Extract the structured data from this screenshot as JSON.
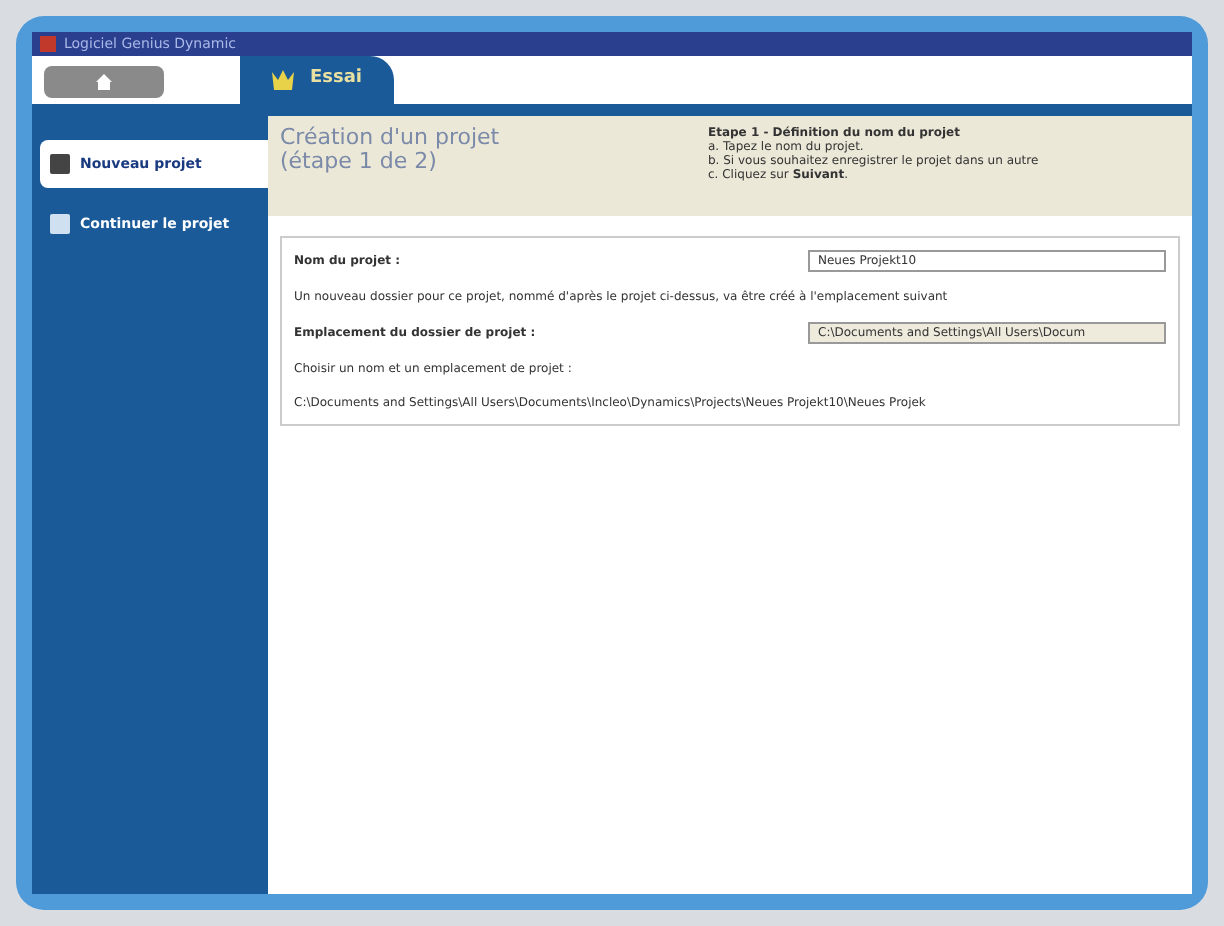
{
  "window": {
    "title": "Logiciel Genius Dynamic"
  },
  "tabs": [
    {
      "label": "Essai",
      "selected": true
    }
  ],
  "sidebar": {
    "items": [
      {
        "label": "Nouveau projet",
        "selected": true
      },
      {
        "label": "Continuer le projet",
        "selected": false
      }
    ]
  },
  "header": {
    "title": "Création d'un projet",
    "subtitle": "(étape 1 de 2)",
    "steps_title": "Etape 1 - Définition du nom du projet",
    "steps": [
      "a. Tapez le nom du projet.",
      "b. Si vous souhaitez enregistrer le projet dans un autre",
      "c. Cliquez sur **Suivant**."
    ]
  },
  "form": {
    "name_label": "Nom du projet :",
    "name_value": "Neues Projekt10",
    "info": "Un nouveau dossier pour ce projet, nommé d'après le projet ci-dessus, va être créé à l'emplacement suivant",
    "location_label": "Emplacement du dossier de projet :",
    "location_value": "C:\\Documents and Settings\\All Users\\Docum",
    "choose_label": "Choisir un nom et un emplacement de projet :",
    "path": "C:\\Documents and Settings\\All Users\\Documents\\Incleo\\Dynamics\\Projects\\Neues Projekt10\\Neues Projek"
  }
}
